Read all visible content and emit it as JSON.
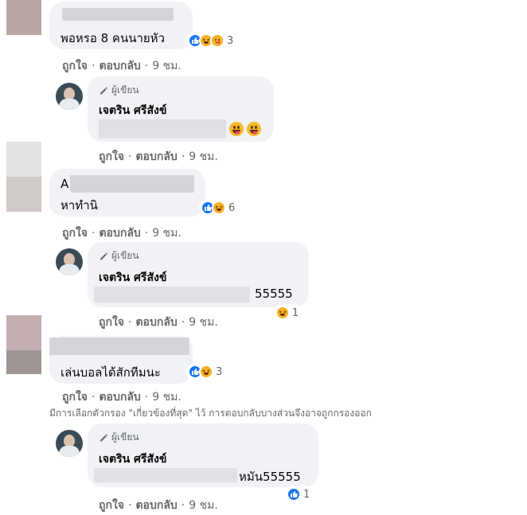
{
  "labels": {
    "author_badge": "ผู้เขียน",
    "like": "ถูกใจ",
    "reply": "ตอบกลับ",
    "separator": "·"
  },
  "comments": [
    {
      "text": "พอหรอ 8 คนนายหัว",
      "time": "9 ชม.",
      "reactions": {
        "icons": [
          "like-icon",
          "haha-icon",
          "care-icon"
        ],
        "count": "3"
      }
    },
    {
      "author_reply": true,
      "name": "เจตริน ศรีสังข์",
      "time": "9 ชม."
    },
    {
      "prefix": "A",
      "text": "หาทำนิ",
      "time": "9 ชม.",
      "reactions": {
        "icons": [
          "like-icon",
          "haha-icon"
        ],
        "count": "6"
      }
    },
    {
      "author_reply": true,
      "name": "เจตริน ศรีสังข์",
      "text_suffix": "55555",
      "time": "9 ชม.",
      "reactions": {
        "icons": [
          "haha-icon"
        ],
        "count": "1"
      }
    },
    {
      "text": "เล่นบอลได้สักทีมนะ",
      "time": "9 ชม.",
      "reactions": {
        "icons": [
          "like-icon",
          "haha-icon"
        ],
        "count": "3"
      }
    },
    {
      "author_reply": true,
      "name": "เจตริน ศรีสังข์",
      "text_suffix": "หมัน55555",
      "time": "9 ชม.",
      "reactions": {
        "icons": [
          "like-icon"
        ],
        "count": "1"
      }
    }
  ],
  "filter_note": "มีการเลือกตัวกรอง \"เกี่ยวข้องที่สุด\" ไว้ การตอบกลับบางส่วนจึงอาจถูกกรองออก",
  "colors": {
    "bubble": "#f0f2f5",
    "like": "#1877f2",
    "reaction_yellow": "#f7b125",
    "meta_text": "#65676b"
  }
}
